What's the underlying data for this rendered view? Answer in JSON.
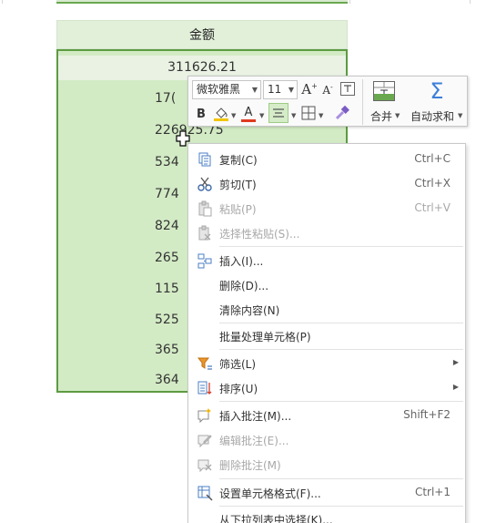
{
  "sheet": {
    "column_header": "金额",
    "first_value": "311626.21",
    "partial_values": [
      "17(",
      "226925.75",
      "534",
      "774",
      "824",
      "265",
      "115",
      "525",
      "365",
      "364"
    ]
  },
  "mini_toolbar": {
    "font_name": "微软雅黑",
    "font_size": "11",
    "increase_font": "A",
    "decrease_font": "A",
    "bold": "B",
    "font_color_letter": "A",
    "merge_label": "合并",
    "autosum_label": "自动求和",
    "fill_color": "#f2c500",
    "font_color": "#e03a1f"
  },
  "context_menu": {
    "items": [
      {
        "label": "复制(C)",
        "shortcut": "Ctrl+C",
        "icon": "copy-icon"
      },
      {
        "label": "剪切(T)",
        "shortcut": "Ctrl+X",
        "icon": "scissors-icon"
      },
      {
        "label": "粘贴(P)",
        "shortcut": "Ctrl+V",
        "icon": "paste-icon"
      },
      {
        "label": "选择性粘贴(S)...",
        "icon": "paste-special-icon"
      },
      {
        "label": "插入(I)...",
        "icon": "insert-cells-icon"
      },
      {
        "label": "删除(D)...",
        "icon": ""
      },
      {
        "label": "清除内容(N)",
        "icon": ""
      },
      {
        "label": "批量处理单元格(P)",
        "icon": ""
      },
      {
        "label": "筛选(L)",
        "icon": "filter-icon"
      },
      {
        "label": "排序(U)",
        "icon": "sort-icon"
      },
      {
        "label": "插入批注(M)...",
        "shortcut": "Shift+F2",
        "icon": "insert-comment-icon"
      },
      {
        "label": "编辑批注(E)...",
        "icon": "edit-comment-icon"
      },
      {
        "label": "删除批注(M)",
        "icon": "delete-comment-icon"
      },
      {
        "label": "设置单元格格式(F)...",
        "shortcut": "Ctrl+1",
        "icon": "format-cells-icon"
      },
      {
        "label": "从下拉列表中选择(K)...",
        "icon": ""
      }
    ]
  }
}
